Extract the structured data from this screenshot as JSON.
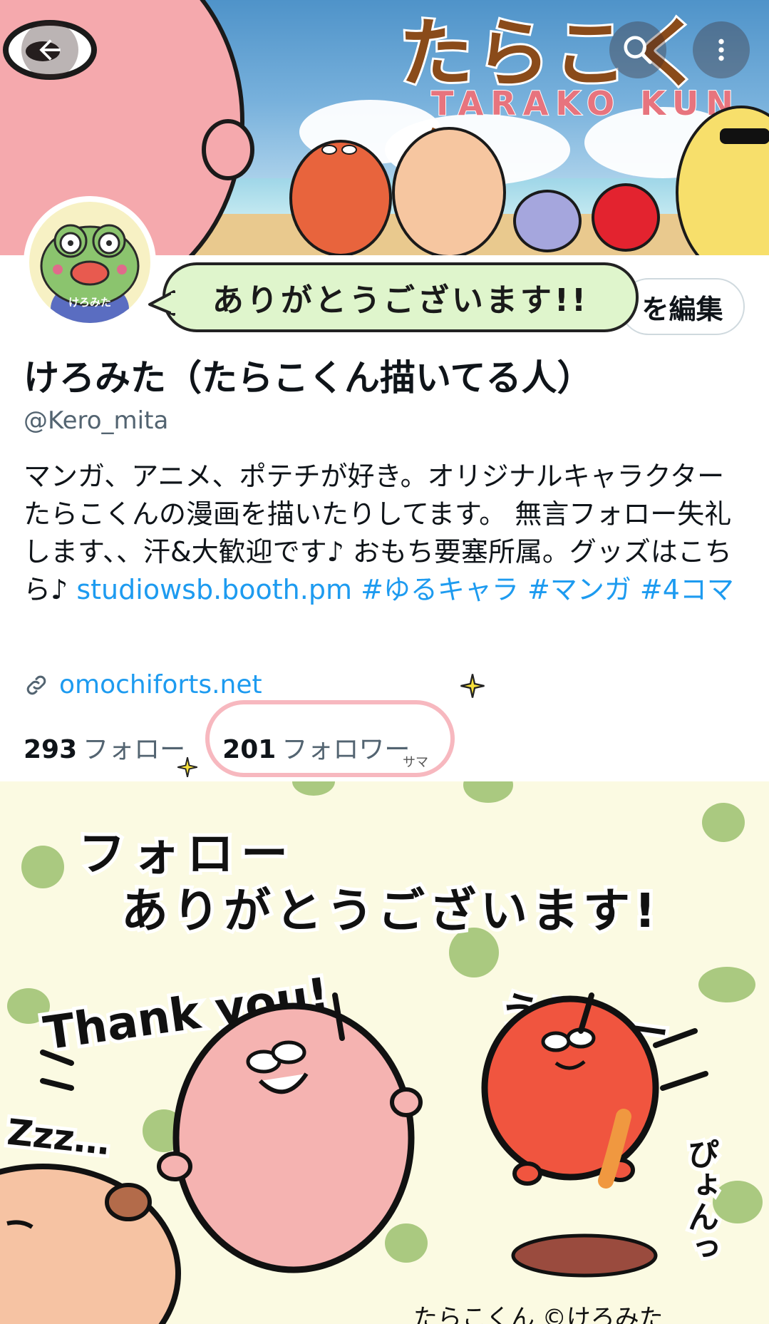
{
  "banner": {
    "title": "たらこくん",
    "subtitle": "TARAKO KUN"
  },
  "topbar": {
    "back_icon": "arrow-left-icon",
    "search_icon": "search-icon",
    "more_icon": "more-vertical-icon"
  },
  "profile": {
    "avatar_label": "けろみた",
    "edit_button_label": "を編集",
    "overlay_speech": "ありがとうございます!!",
    "display_name": "けろみた（たらこくん描いてる人）",
    "handle": "@Kero_mita",
    "bio_text": "マンガ、アニメ、ポテチが好き。オリジナルキャラクターたらこくんの漫画を描いたりしてます。 無言フォロー失礼します、、汗&大歓迎です♪ おもち要塞所属。グッズはこちら♪",
    "bio_link": "studiowsb.booth.pm",
    "bio_tags": "#ゆるキャラ #マンガ #4コマ",
    "website": "omochiforts.net",
    "following_count": "293",
    "following_label": "フォロー",
    "followers_count": "201",
    "followers_label": "フォロワー",
    "sama_note": "サマ"
  },
  "illustration": {
    "line1": "フォロー",
    "line2": "ありがとうございます!",
    "thank_you": "Thank you!",
    "ureshii": "うれしー",
    "zzz": "Zzz…",
    "pyon": "ぴょんっ",
    "credit": "たらこくん ©けろみた"
  },
  "colors": {
    "link": "#1d9bf0",
    "text": "#0f1419",
    "muted": "#536471",
    "pink_character": "#f5b3b1",
    "red_character": "#f0553f"
  }
}
